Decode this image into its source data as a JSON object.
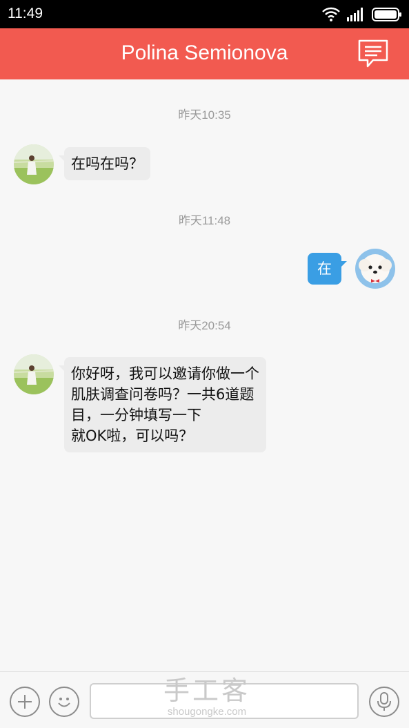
{
  "status": {
    "time": "11:49"
  },
  "header": {
    "title": "Polina Semionova"
  },
  "messages": [
    {
      "time": "昨天10:35",
      "text": "在吗在吗？",
      "direction": "incoming"
    },
    {
      "time": "昨天11:48",
      "text": "在",
      "direction": "outgoing"
    },
    {
      "time": "昨天20:54",
      "lines": [
        "你好呀，我可以邀请你做一个",
        "肌肤调查问卷吗？一共6道题",
        "目，一分钟填写一下",
        "就OK啦，可以吗？"
      ],
      "direction": "incoming"
    }
  ],
  "input": {
    "value": "",
    "placeholder": ""
  },
  "watermark": {
    "big": "手工客",
    "small": "shougongke.com"
  },
  "colors": {
    "header": "#f25a50",
    "outgoing_bubble": "#3a9ee4",
    "incoming_bubble": "#ececec"
  },
  "icons": [
    "wifi-icon",
    "signal-icon",
    "battery-icon",
    "compose-message-icon",
    "plus-icon",
    "smiley-icon",
    "microphone-icon"
  ]
}
